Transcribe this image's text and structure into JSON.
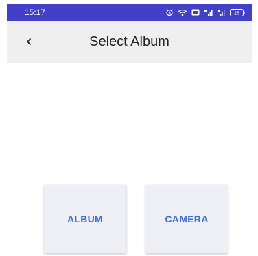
{
  "status_bar": {
    "time": "15:17",
    "battery": "26",
    "background": "#4240c8",
    "icons": [
      "alarm-icon",
      "wifi-icon",
      "hd-icon",
      "signal-icon",
      "signal-icon-2",
      "battery-icon"
    ]
  },
  "app_bar": {
    "back_icon": "chevron-left-icon",
    "title": "Select Album",
    "background": "#efefef"
  },
  "actions": {
    "album_label": "ALBUM",
    "camera_label": "CAMERA",
    "accent": "#3c6fd6"
  }
}
